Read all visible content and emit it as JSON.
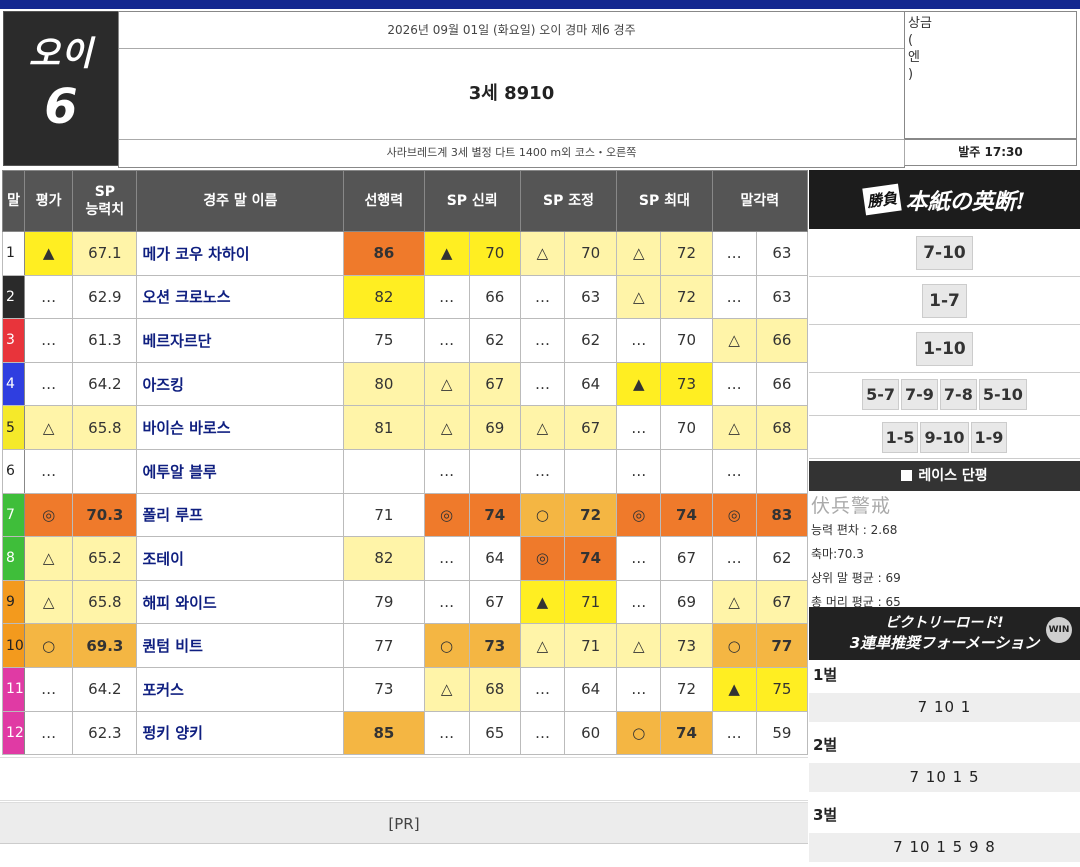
{
  "venue": {
    "name": "오이",
    "race_no": "6"
  },
  "header": {
    "date_line": "2026년 09월 01일 (화요일) 오이 경마 제6 경주",
    "race_title": "3세 8910",
    "conditions": "사라브레드계 3세 별정 다트 1400 m외 코스・오른쪽",
    "prize_lines": [
      "상금",
      "(",
      "엔",
      ")"
    ],
    "start_time": "발주 17:30"
  },
  "table": {
    "headers": [
      "말",
      "평가",
      "SP\n능력치",
      "경주 말 이름",
      "선행력",
      "SP 신뢰",
      "SP 조정",
      "SP 최대",
      "말각력"
    ],
    "rows": [
      {
        "no": "1",
        "eval": "▲",
        "sp": "67.1",
        "name": "메가 코우 차하이",
        "lead": "86",
        "t_m": "▲",
        "t_v": "70",
        "a_m": "△",
        "a_v": "70",
        "x_m": "△",
        "x_v": "72",
        "k_m": "…",
        "k_v": "63"
      },
      {
        "no": "2",
        "eval": "…",
        "sp": "62.9",
        "name": "오션 크로노스",
        "lead": "82",
        "t_m": "…",
        "t_v": "66",
        "a_m": "…",
        "a_v": "63",
        "x_m": "△",
        "x_v": "72",
        "k_m": "…",
        "k_v": "63"
      },
      {
        "no": "3",
        "eval": "…",
        "sp": "61.3",
        "name": "베르자르단",
        "lead": "75",
        "t_m": "…",
        "t_v": "62",
        "a_m": "…",
        "a_v": "62",
        "x_m": "…",
        "x_v": "70",
        "k_m": "△",
        "k_v": "66"
      },
      {
        "no": "4",
        "eval": "…",
        "sp": "64.2",
        "name": "아즈킹",
        "lead": "80",
        "t_m": "△",
        "t_v": "67",
        "a_m": "…",
        "a_v": "64",
        "x_m": "▲",
        "x_v": "73",
        "k_m": "…",
        "k_v": "66"
      },
      {
        "no": "5",
        "eval": "△",
        "sp": "65.8",
        "name": "바이슨 바로스",
        "lead": "81",
        "t_m": "△",
        "t_v": "69",
        "a_m": "△",
        "a_v": "67",
        "x_m": "…",
        "x_v": "70",
        "k_m": "△",
        "k_v": "68"
      },
      {
        "no": "6",
        "eval": "…",
        "sp": "",
        "name": "에투알 블루",
        "lead": "",
        "t_m": "…",
        "t_v": "",
        "a_m": "…",
        "a_v": "",
        "x_m": "…",
        "x_v": "",
        "k_m": "…",
        "k_v": ""
      },
      {
        "no": "7",
        "eval": "◎",
        "sp": "70.3",
        "name": "폴리 루프",
        "lead": "71",
        "t_m": "◎",
        "t_v": "74",
        "a_m": "○",
        "a_v": "72",
        "x_m": "◎",
        "x_v": "74",
        "k_m": "◎",
        "k_v": "83"
      },
      {
        "no": "8",
        "eval": "△",
        "sp": "65.2",
        "name": "조테이",
        "lead": "82",
        "t_m": "…",
        "t_v": "64",
        "a_m": "◎",
        "a_v": "74",
        "x_m": "…",
        "x_v": "67",
        "k_m": "…",
        "k_v": "62"
      },
      {
        "no": "9",
        "eval": "△",
        "sp": "65.8",
        "name": "해피 와이드",
        "lead": "79",
        "t_m": "…",
        "t_v": "67",
        "a_m": "▲",
        "a_v": "71",
        "x_m": "…",
        "x_v": "69",
        "k_m": "△",
        "k_v": "67"
      },
      {
        "no": "10",
        "eval": "○",
        "sp": "69.3",
        "name": "퀀텀 비트",
        "lead": "77",
        "t_m": "○",
        "t_v": "73",
        "a_m": "△",
        "a_v": "71",
        "x_m": "△",
        "x_v": "73",
        "k_m": "○",
        "k_v": "77"
      },
      {
        "no": "11",
        "eval": "…",
        "sp": "64.2",
        "name": "포커스",
        "lead": "73",
        "t_m": "△",
        "t_v": "68",
        "a_m": "…",
        "a_v": "64",
        "x_m": "…",
        "x_v": "72",
        "k_m": "▲",
        "k_v": "75"
      },
      {
        "no": "12",
        "eval": "…",
        "sp": "62.3",
        "name": "펑키 양키",
        "lead": "85",
        "t_m": "…",
        "t_v": "65",
        "a_m": "…",
        "a_v": "60",
        "x_m": "○",
        "x_v": "74",
        "k_m": "…",
        "k_v": "59"
      }
    ]
  },
  "frame_colors": [
    "#ffffff",
    "#2a2a2a",
    "#e8343b",
    "#2f3ee0",
    "#f5e92a",
    "#ffffff",
    "#3fbe3a",
    "#3fbe3a",
    "#f39a1d",
    "#f39a1d",
    "#e03aa4",
    "#e03aa4"
  ],
  "pr_label": "[PR]",
  "right": {
    "banner1_stamp": "勝負",
    "banner1_text": "本紙の英断!",
    "picks": [
      [
        "7-10"
      ],
      [
        "1-7"
      ],
      [
        "1-10"
      ],
      [
        "5-7",
        "7-9",
        "7-8",
        "5-10"
      ],
      [
        "1-5",
        "9-10",
        "1-9"
      ]
    ],
    "comment_title": "레이스 단평",
    "comment_stamp": "伏兵警戒",
    "comment_lines": [
      "능력 편차 : 2.68",
      "축마:70.3",
      "상위 말 평균 : 69",
      "총 머리 평균 : 65"
    ],
    "banner2_line1": "ビクトリーロード!",
    "banner2_line2": "3連単推奨フォーメーション",
    "banner2_badge": "WIN",
    "tiers": [
      {
        "label": "1벌",
        "value": "7 10 1"
      },
      {
        "label": "2벌",
        "value": "7 10 1 5"
      },
      {
        "label": "3벌",
        "value": "7 10 1 5 9 8"
      }
    ]
  }
}
